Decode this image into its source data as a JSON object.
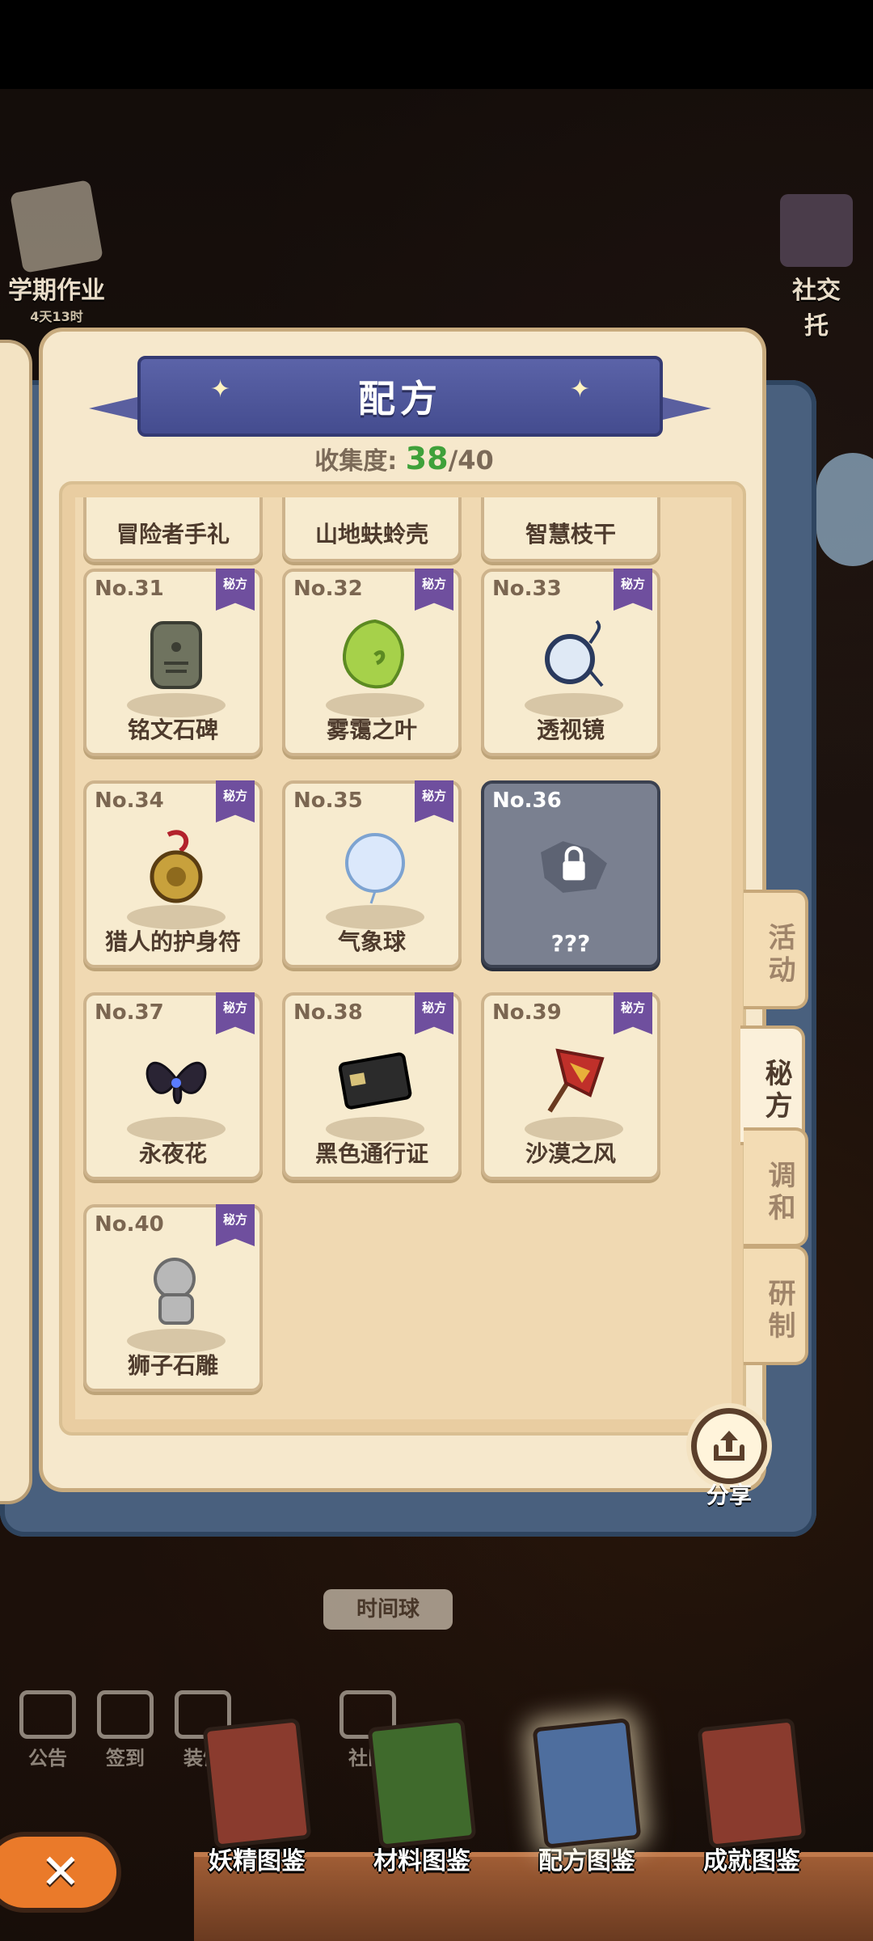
{
  "header": {
    "title": "配方"
  },
  "collection": {
    "label": "收集度:",
    "count": "38",
    "total": "/40"
  },
  "side_buttons": {
    "left": {
      "label": "学期作业",
      "sub": "4天13时"
    },
    "right": {
      "label": "社交",
      "sub": "托"
    }
  },
  "partial_row": [
    {
      "name": "冒险者手礼"
    },
    {
      "name": "山地蚨蛉壳"
    },
    {
      "name": "智慧枝干"
    }
  ],
  "secret_badge": "秘方",
  "cards": [
    {
      "no": "No.31",
      "name": "铭文石碑",
      "icon": "stone-tablet-icon",
      "locked": false
    },
    {
      "no": "No.32",
      "name": "雾霭之叶",
      "icon": "leaf-icon",
      "locked": false
    },
    {
      "no": "No.33",
      "name": "透视镜",
      "icon": "monocle-icon",
      "locked": false
    },
    {
      "no": "No.34",
      "name": "猎人的护身符",
      "icon": "amulet-icon",
      "locked": false
    },
    {
      "no": "No.35",
      "name": "气象球",
      "icon": "balloon-icon",
      "locked": false
    },
    {
      "no": "No.36",
      "name": "???",
      "icon": "lock-icon",
      "locked": true
    },
    {
      "no": "No.37",
      "name": "永夜花",
      "icon": "dark-flower-icon",
      "locked": false
    },
    {
      "no": "No.38",
      "name": "黑色通行证",
      "icon": "pass-card-icon",
      "locked": false
    },
    {
      "no": "No.39",
      "name": "沙漠之风",
      "icon": "flag-icon",
      "locked": false
    },
    {
      "no": "No.40",
      "name": "狮子石雕",
      "icon": "lion-statue-icon",
      "locked": false
    }
  ],
  "tabs": [
    {
      "label": "活动",
      "active": false
    },
    {
      "label": "秘方",
      "active": true
    },
    {
      "label": "调和",
      "active": false
    },
    {
      "label": "研制",
      "active": false
    }
  ],
  "share": {
    "label": "分享"
  },
  "hud": [
    {
      "label": "公告"
    },
    {
      "label": "签到"
    },
    {
      "label": "装饰"
    },
    {
      "label": "社区"
    }
  ],
  "time_ball": "时间球",
  "bottom_nav": [
    {
      "label": "妖精图鉴",
      "color": "#8a3b2e",
      "active": false
    },
    {
      "label": "材料图鉴",
      "color": "#3f6a2c",
      "active": false
    },
    {
      "label": "配方图鉴",
      "color": "#4e6e9e",
      "active": true
    },
    {
      "label": "成就图鉴",
      "color": "#8a3b2e",
      "active": false
    }
  ],
  "colors": {
    "banner": "#4e57a0",
    "accent_green": "#3fa13a",
    "secret_badge": "#6f4f9e",
    "close": "#ea7a2a"
  }
}
